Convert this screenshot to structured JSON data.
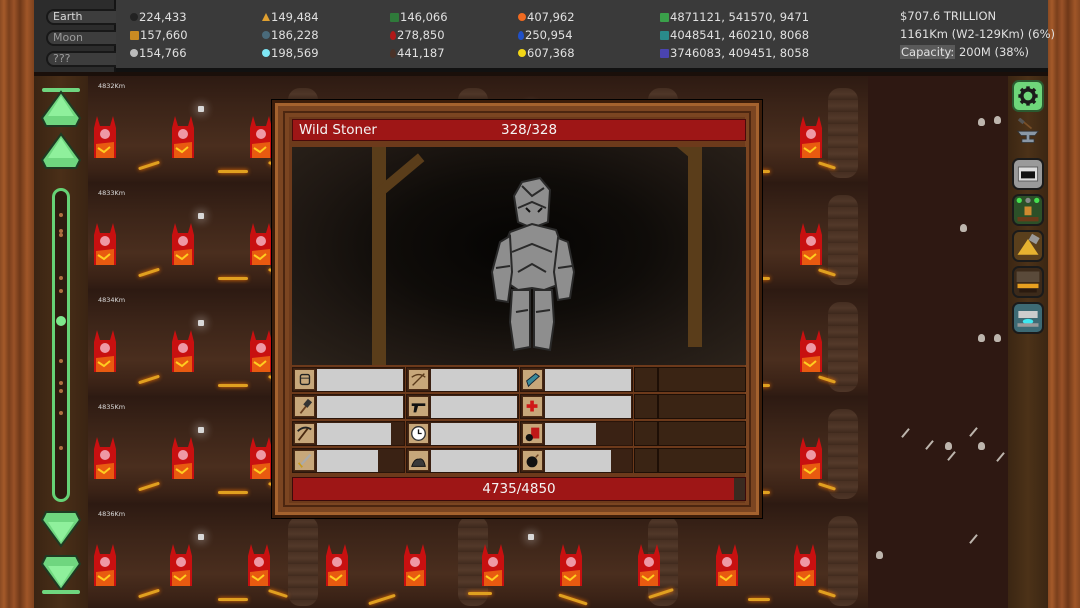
{
  "worlds": [
    {
      "label": "Earth",
      "active": true
    },
    {
      "label": "Moon",
      "active": false
    },
    {
      "label": "???",
      "active": false
    }
  ],
  "resources": [
    {
      "icon": "coal-icon",
      "color": "#222222",
      "value": "224,433"
    },
    {
      "icon": "gold-ore-icon",
      "color": "#c98a22",
      "value": "157,660"
    },
    {
      "icon": "silver-ore-icon",
      "color": "#bbbbbb",
      "value": "154,766"
    },
    {
      "icon": "gold-nugget-icon",
      "color": "#e0a030",
      "value": "149,484"
    },
    {
      "icon": "platinum-icon",
      "color": "#4a6a7a",
      "value": "186,228"
    },
    {
      "icon": "diamond-icon",
      "color": "#7fe7f5",
      "value": "198,569"
    },
    {
      "icon": "emerald-icon",
      "color": "#2f7a3a",
      "value": "146,066"
    },
    {
      "icon": "ruby-icon",
      "color": "#b01818",
      "value": "278,850"
    },
    {
      "icon": "obsidian-icon",
      "color": "#4a3228",
      "value": "441,187"
    },
    {
      "icon": "amber-icon",
      "color": "#f06a20",
      "value": "407,962"
    },
    {
      "icon": "sapphire-icon",
      "color": "#2050c8",
      "value": "250,954"
    },
    {
      "icon": "topaz-icon",
      "color": "#f2d616",
      "value": "607,368"
    },
    {
      "icon": "green-chest-icon",
      "color": "#3aa04a",
      "value": "4871121, 541570, 9471"
    },
    {
      "icon": "teal-chest-icon",
      "color": "#2a8a8a",
      "value": "4048541, 460210, 8068"
    },
    {
      "icon": "purple-chest-icon",
      "color": "#4a44b0",
      "value": "3746083, 409451, 8058"
    }
  ],
  "stats": {
    "money": "$707.6 TRILLION",
    "depth": "1161Km (W2-129Km) (6%)",
    "capacity_label": "Capacity:",
    "capacity_value": " 200M (38%)"
  },
  "depth_labels": [
    "4832Km",
    "4833Km",
    "4834Km",
    "4835Km",
    "4836Km"
  ],
  "depth_slider": {
    "position_fraction": 0.42
  },
  "toolbar": [
    {
      "name": "settings-button",
      "icon": "gear-icon"
    },
    {
      "name": "blacksmith-button",
      "icon": "anvil-icon"
    },
    {
      "name": "mine-cart-button",
      "icon": "mine-entrance-icon"
    },
    {
      "name": "miner-button",
      "icon": "miner-icon"
    },
    {
      "name": "drill-button",
      "icon": "drill-icon"
    },
    {
      "name": "forge-button",
      "icon": "furnace-icon"
    },
    {
      "name": "teleporter-button",
      "icon": "teleporter-icon"
    }
  ],
  "battle": {
    "monster_name": "Wild Stoner",
    "monster_hp": "328/328",
    "monster_hp_fraction": 1.0,
    "player_hp": "4735/4850",
    "player_hp_fraction": 0.976,
    "weapons": [
      [
        {
          "icon": "fist-icon",
          "cooldown_fraction": 1.0
        },
        {
          "icon": "crossbow-icon",
          "cooldown_fraction": 1.0
        },
        {
          "icon": "ray-gun-icon",
          "cooldown_fraction": 1.0
        }
      ],
      [
        {
          "icon": "hammer-icon",
          "cooldown_fraction": 1.0
        },
        {
          "icon": "pistol-icon",
          "cooldown_fraction": 1.0
        },
        {
          "icon": "medkit-icon",
          "cooldown_fraction": 1.0
        }
      ],
      [
        {
          "icon": "pickaxe-icon",
          "cooldown_fraction": 0.86
        },
        {
          "icon": "clock-icon",
          "cooldown_fraction": 1.0
        },
        {
          "icon": "dynamite-icon",
          "cooldown_fraction": 0.59
        }
      ],
      [
        {
          "icon": "sword-icon",
          "cooldown_fraction": 0.71
        },
        {
          "icon": "rock-pile-icon",
          "cooldown_fraction": 1.0
        },
        {
          "icon": "bomb-icon",
          "cooldown_fraction": 0.77
        }
      ]
    ]
  }
}
